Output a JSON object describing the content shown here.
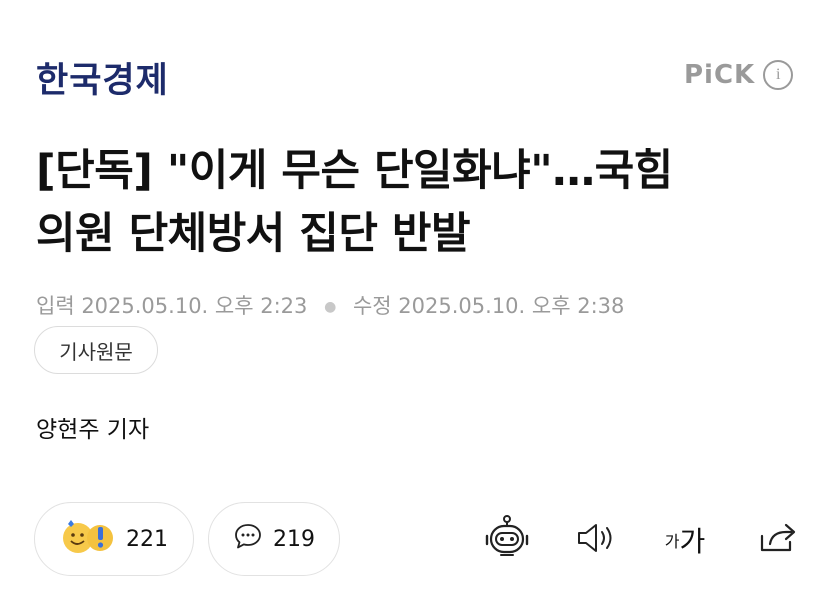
{
  "header": {
    "brand": "한국경제",
    "pick_label": "PiCK",
    "info_glyph": "i"
  },
  "article": {
    "title_line1": "[단독] \"이게 무슨 단일화냐\"…국힘",
    "title_line2": "의원 단체방서 집단 반발",
    "published": "입력 2025.05.10. 오후 2:23",
    "updated": "수정 2025.05.10. 오후 2:38",
    "source_button": "기사원문",
    "reporter": "양현주 기자"
  },
  "actions": {
    "reaction_count": "221",
    "comment_count": "219",
    "font_size_small": "가",
    "font_size_big": "가",
    "icons": {
      "reaction": "reaction-emoji-icon",
      "comment": "speech-bubble-icon",
      "summary_bot": "robot-icon",
      "tts": "speaker-icon",
      "share": "share-icon"
    }
  },
  "colors": {
    "brand": "#1d2b6b",
    "meta_text": "#9a9a9a",
    "border": "#e2e2e2"
  }
}
